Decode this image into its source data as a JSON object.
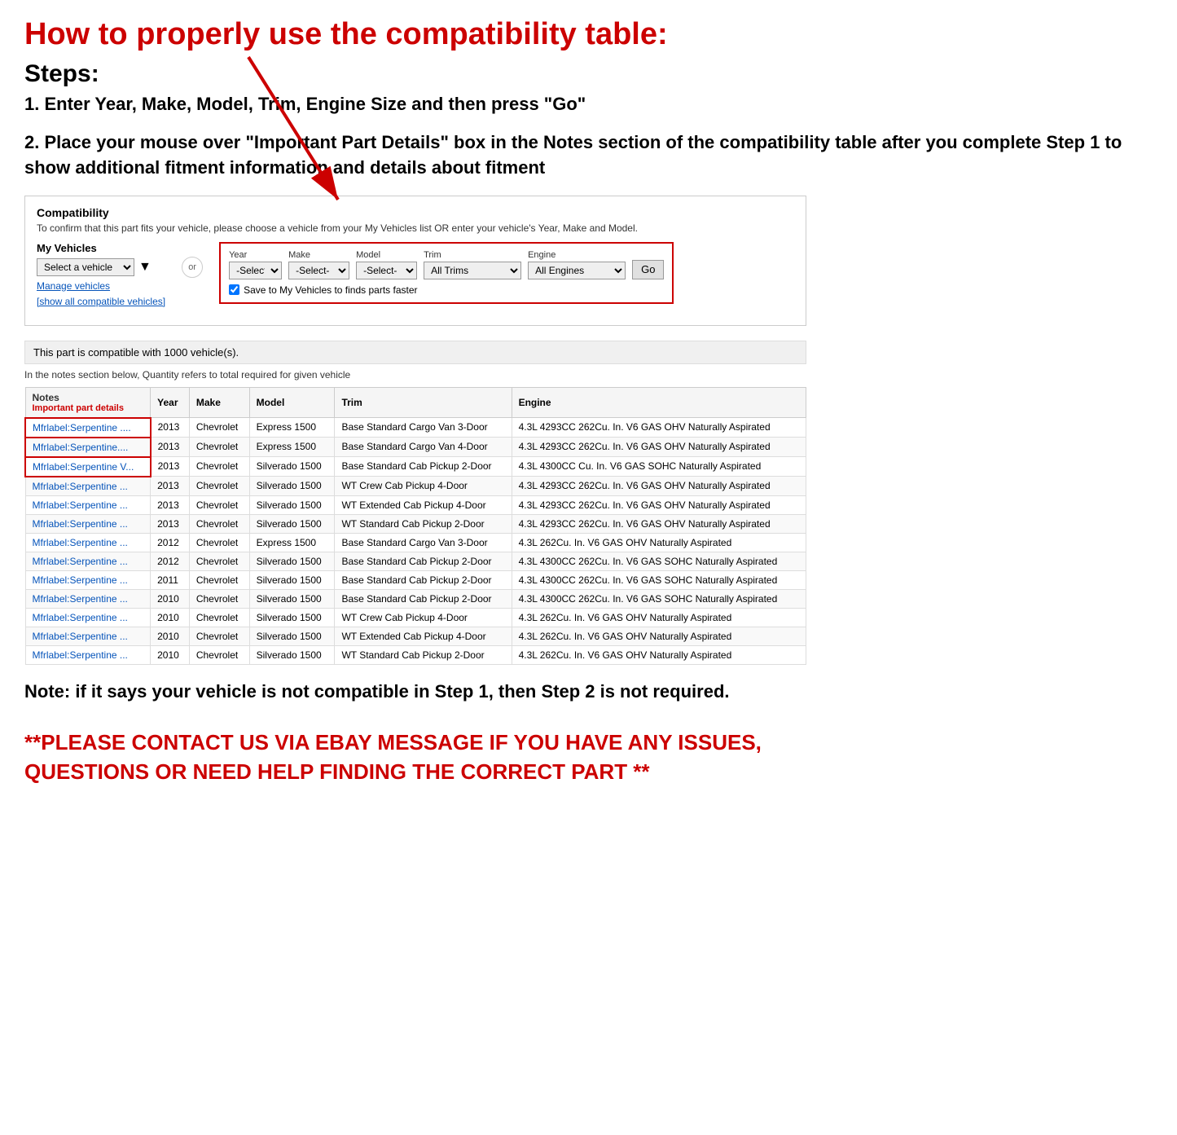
{
  "title": "How to properly use the compatibility table:",
  "steps_heading": "Steps:",
  "step1": "1. Enter Year, Make, Model, Trim, Engine Size and then press \"Go\"",
  "step2": "2. Place your mouse over \"Important Part Details\" box in the Notes section of the compatibility table after you complete Step 1 to show additional fitment information and details about fitment",
  "compatibility": {
    "section_title": "Compatibility",
    "subtitle": "To confirm that this part fits your vehicle, please choose a vehicle from your My Vehicles list OR enter your vehicle's Year, Make and Model.",
    "my_vehicles_label": "My Vehicles",
    "select_vehicle_placeholder": "Select a vehicle",
    "manage_vehicles": "Manage vehicles",
    "show_all": "[show all compatible vehicles]",
    "or_label": "or",
    "year_label": "Year",
    "year_default": "-Select-",
    "make_label": "Make",
    "make_default": "-Select-",
    "model_label": "Model",
    "model_default": "-Select-",
    "trim_label": "Trim",
    "trim_default": "All Trims",
    "engine_label": "Engine",
    "engine_default": "All Engines",
    "go_button": "Go",
    "save_checkbox_label": "Save to My Vehicles to finds parts faster",
    "compatible_count": "This part is compatible with 1000 vehicle(s).",
    "quantity_note": "In the notes section below, Quantity refers to total required for given vehicle",
    "table_headers": [
      "Notes",
      "Year",
      "Make",
      "Model",
      "Trim",
      "Engine"
    ],
    "notes_header_sub": "Important part details",
    "rows": [
      {
        "notes": "Mfrlabel:Serpentine ....",
        "year": "2013",
        "make": "Chevrolet",
        "model": "Express 1500",
        "trim": "Base Standard Cargo Van 3-Door",
        "engine": "4.3L 4293CC 262Cu. In. V6 GAS OHV Naturally Aspirated",
        "highlight": true
      },
      {
        "notes": "Mfrlabel:Serpentine....",
        "year": "2013",
        "make": "Chevrolet",
        "model": "Express 1500",
        "trim": "Base Standard Cargo Van 4-Door",
        "engine": "4.3L 4293CC 262Cu. In. V6 GAS OHV Naturally Aspirated",
        "highlight": true
      },
      {
        "notes": "Mfrlabel:Serpentine V...",
        "year": "2013",
        "make": "Chevrolet",
        "model": "Silverado 1500",
        "trim": "Base Standard Cab Pickup 2-Door",
        "engine": "4.3L 4300CC Cu. In. V6 GAS SOHC Naturally Aspirated",
        "highlight": true
      },
      {
        "notes": "Mfrlabel:Serpentine ...",
        "year": "2013",
        "make": "Chevrolet",
        "model": "Silverado 1500",
        "trim": "WT Crew Cab Pickup 4-Door",
        "engine": "4.3L 4293CC 262Cu. In. V6 GAS OHV Naturally Aspirated",
        "highlight": false
      },
      {
        "notes": "Mfrlabel:Serpentine ...",
        "year": "2013",
        "make": "Chevrolet",
        "model": "Silverado 1500",
        "trim": "WT Extended Cab Pickup 4-Door",
        "engine": "4.3L 4293CC 262Cu. In. V6 GAS OHV Naturally Aspirated",
        "highlight": false
      },
      {
        "notes": "Mfrlabel:Serpentine ...",
        "year": "2013",
        "make": "Chevrolet",
        "model": "Silverado 1500",
        "trim": "WT Standard Cab Pickup 2-Door",
        "engine": "4.3L 4293CC 262Cu. In. V6 GAS OHV Naturally Aspirated",
        "highlight": false
      },
      {
        "notes": "Mfrlabel:Serpentine ...",
        "year": "2012",
        "make": "Chevrolet",
        "model": "Express 1500",
        "trim": "Base Standard Cargo Van 3-Door",
        "engine": "4.3L 262Cu. In. V6 GAS OHV Naturally Aspirated",
        "highlight": false
      },
      {
        "notes": "Mfrlabel:Serpentine ...",
        "year": "2012",
        "make": "Chevrolet",
        "model": "Silverado 1500",
        "trim": "Base Standard Cab Pickup 2-Door",
        "engine": "4.3L 4300CC 262Cu. In. V6 GAS SOHC Naturally Aspirated",
        "highlight": false
      },
      {
        "notes": "Mfrlabel:Serpentine ...",
        "year": "2011",
        "make": "Chevrolet",
        "model": "Silverado 1500",
        "trim": "Base Standard Cab Pickup 2-Door",
        "engine": "4.3L 4300CC 262Cu. In. V6 GAS SOHC Naturally Aspirated",
        "highlight": false
      },
      {
        "notes": "Mfrlabel:Serpentine ...",
        "year": "2010",
        "make": "Chevrolet",
        "model": "Silverado 1500",
        "trim": "Base Standard Cab Pickup 2-Door",
        "engine": "4.3L 4300CC 262Cu. In. V6 GAS SOHC Naturally Aspirated",
        "highlight": false
      },
      {
        "notes": "Mfrlabel:Serpentine ...",
        "year": "2010",
        "make": "Chevrolet",
        "model": "Silverado 1500",
        "trim": "WT Crew Cab Pickup 4-Door",
        "engine": "4.3L 262Cu. In. V6 GAS OHV Naturally Aspirated",
        "highlight": false
      },
      {
        "notes": "Mfrlabel:Serpentine ...",
        "year": "2010",
        "make": "Chevrolet",
        "model": "Silverado 1500",
        "trim": "WT Extended Cab Pickup 4-Door",
        "engine": "4.3L 262Cu. In. V6 GAS OHV Naturally Aspirated",
        "highlight": false
      },
      {
        "notes": "Mfrlabel:Serpentine ...",
        "year": "2010",
        "make": "Chevrolet",
        "model": "Silverado 1500",
        "trim": "WT Standard Cab Pickup 2-Door",
        "engine": "4.3L 262Cu. In. V6 GAS OHV Naturally Aspirated",
        "highlight": false
      }
    ]
  },
  "note_text": "Note: if it says your vehicle is not compatible in Step 1, then Step 2 is not required.",
  "contact_text": "**PLEASE CONTACT US VIA EBAY MESSAGE IF YOU HAVE ANY ISSUES, QUESTIONS OR NEED HELP FINDING THE CORRECT PART **"
}
